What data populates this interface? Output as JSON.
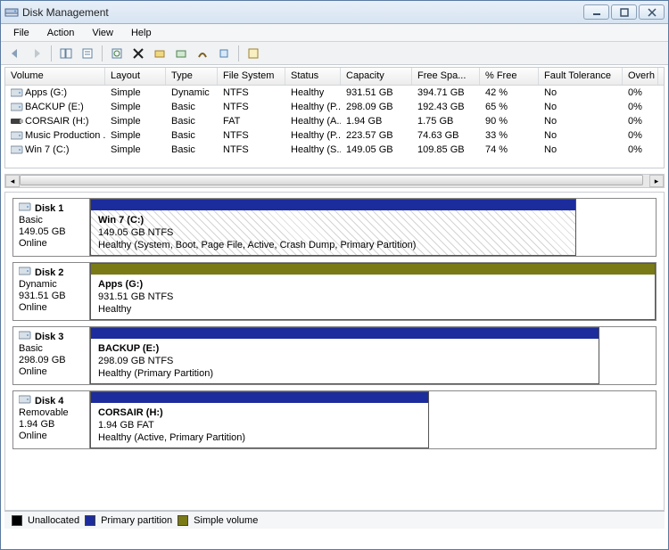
{
  "window": {
    "title": "Disk Management"
  },
  "menu": {
    "file": "File",
    "action": "Action",
    "view": "View",
    "help": "Help"
  },
  "columns": {
    "volume": "Volume",
    "layout": "Layout",
    "type": "Type",
    "fs": "File System",
    "status": "Status",
    "capacity": "Capacity",
    "free": "Free Spa...",
    "pctfree": "% Free",
    "fault": "Fault Tolerance",
    "over": "Overh"
  },
  "volumes": [
    {
      "name": "Apps (G:)",
      "layout": "Simple",
      "type": "Dynamic",
      "fs": "NTFS",
      "status": "Healthy",
      "cap": "931.51 GB",
      "free": "394.71 GB",
      "pct": "42 %",
      "fault": "No",
      "over": "0%",
      "icon": "drive"
    },
    {
      "name": "BACKUP (E:)",
      "layout": "Simple",
      "type": "Basic",
      "fs": "NTFS",
      "status": "Healthy (P...",
      "cap": "298.09 GB",
      "free": "192.43 GB",
      "pct": "65 %",
      "fault": "No",
      "over": "0%",
      "icon": "drive"
    },
    {
      "name": "CORSAIR (H:)",
      "layout": "Simple",
      "type": "Basic",
      "fs": "FAT",
      "status": "Healthy (A...",
      "cap": "1.94 GB",
      "free": "1.75 GB",
      "pct": "90 %",
      "fault": "No",
      "over": "0%",
      "icon": "usb"
    },
    {
      "name": "Music Production ...",
      "layout": "Simple",
      "type": "Basic",
      "fs": "NTFS",
      "status": "Healthy (P...",
      "cap": "223.57 GB",
      "free": "74.63 GB",
      "pct": "33 %",
      "fault": "No",
      "over": "0%",
      "icon": "drive"
    },
    {
      "name": "Win 7 (C:)",
      "layout": "Simple",
      "type": "Basic",
      "fs": "NTFS",
      "status": "Healthy (S...",
      "cap": "149.05 GB",
      "free": "109.85 GB",
      "pct": "74 %",
      "fault": "No",
      "over": "0%",
      "icon": "drive"
    }
  ],
  "disks": [
    {
      "name": "Disk 1",
      "kind": "Basic",
      "size": "149.05 GB",
      "state": "Online",
      "bar_color": "#1c2c9c",
      "width_pct": 86,
      "hatched": true,
      "part": {
        "title": "Win 7  (C:)",
        "line2": "149.05 GB NTFS",
        "line3": "Healthy (System, Boot, Page File, Active, Crash Dump, Primary Partition)"
      }
    },
    {
      "name": "Disk 2",
      "kind": "Dynamic",
      "size": "931.51 GB",
      "state": "Online",
      "bar_color": "#7a7a16",
      "width_pct": 100,
      "hatched": false,
      "part": {
        "title": "Apps  (G:)",
        "line2": "931.51 GB NTFS",
        "line3": "Healthy"
      }
    },
    {
      "name": "Disk 3",
      "kind": "Basic",
      "size": "298.09 GB",
      "state": "Online",
      "bar_color": "#1c2c9c",
      "width_pct": 90,
      "hatched": false,
      "part": {
        "title": "BACKUP  (E:)",
        "line2": "298.09 GB NTFS",
        "line3": "Healthy (Primary Partition)"
      }
    },
    {
      "name": "Disk 4",
      "kind": "Removable",
      "size": "1.94 GB",
      "state": "Online",
      "bar_color": "#1c2c9c",
      "width_pct": 60,
      "hatched": false,
      "part": {
        "title": "CORSAIR  (H:)",
        "line2": "1.94 GB FAT",
        "line3": "Healthy (Active, Primary Partition)"
      }
    }
  ],
  "legend": {
    "unalloc": "Unallocated",
    "unalloc_color": "#000000",
    "primary": "Primary partition",
    "primary_color": "#1c2c9c",
    "simple": "Simple volume",
    "simple_color": "#7a7a16"
  }
}
